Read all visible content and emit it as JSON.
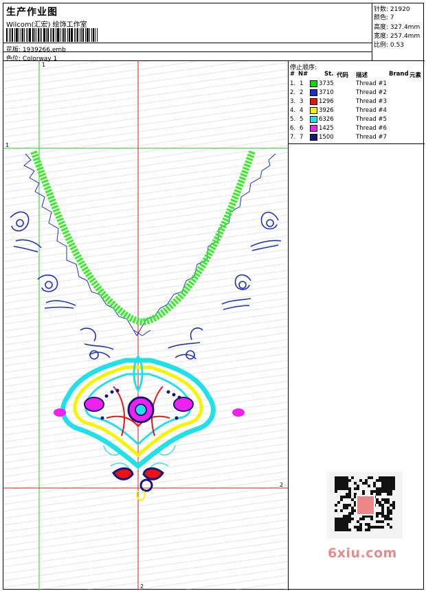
{
  "header": {
    "title": "生产作业图",
    "company": "Wilcom(汇宏) 绘饰工作室",
    "pattern_label": "花版:",
    "pattern_value": "1939266.emb",
    "colorway_label": "色位:",
    "colorway_value": "Colorway 1"
  },
  "stats": {
    "stitches_label": "针数:",
    "stitches": "21920",
    "colors_label": "颜色:",
    "colors": "7",
    "height_label": "高度:",
    "height": "327.4mm",
    "width_label": "宽度:",
    "width": "257.4mm",
    "scale_label": "比例:",
    "scale": "0.53"
  },
  "stop_sequence": {
    "title": "停止顺序:",
    "headers": {
      "hash": "#",
      "n": "N#",
      "st": "St.",
      "code": "代码",
      "desc": "描述",
      "brand": "Brand",
      "element": "元素"
    },
    "rows": [
      {
        "num": "1.",
        "n": "1",
        "code": "3735",
        "desc": "Thread #1",
        "color": "#00dd00"
      },
      {
        "num": "2.",
        "n": "2",
        "code": "3710",
        "desc": "Thread #2",
        "color": "#1a2fc8"
      },
      {
        "num": "3.",
        "n": "3",
        "code": "1296",
        "desc": "Thread #3",
        "color": "#ee1111"
      },
      {
        "num": "4.",
        "n": "4",
        "code": "3926",
        "desc": "Thread #4",
        "color": "#f5f500"
      },
      {
        "num": "5.",
        "n": "5",
        "code": "6326",
        "desc": "Thread #5",
        "color": "#22e0e8"
      },
      {
        "num": "6.",
        "n": "6",
        "code": "1425",
        "desc": "Thread #6",
        "color": "#ee22ee"
      },
      {
        "num": "7.",
        "n": "7",
        "code": "1500",
        "desc": "Thread #7",
        "color": "#15157a"
      }
    ]
  },
  "guides": {
    "v1": "1",
    "h1": "1",
    "h2": "2",
    "v2": "2"
  },
  "watermark": "6xiu.com",
  "colors": {
    "green": "#33ee22",
    "blue": "#1a2fc8",
    "cyan": "#22e0e8",
    "yellow": "#f5f500",
    "magenta": "#ee22ee",
    "red": "#ee1111",
    "navy": "#15157a"
  }
}
